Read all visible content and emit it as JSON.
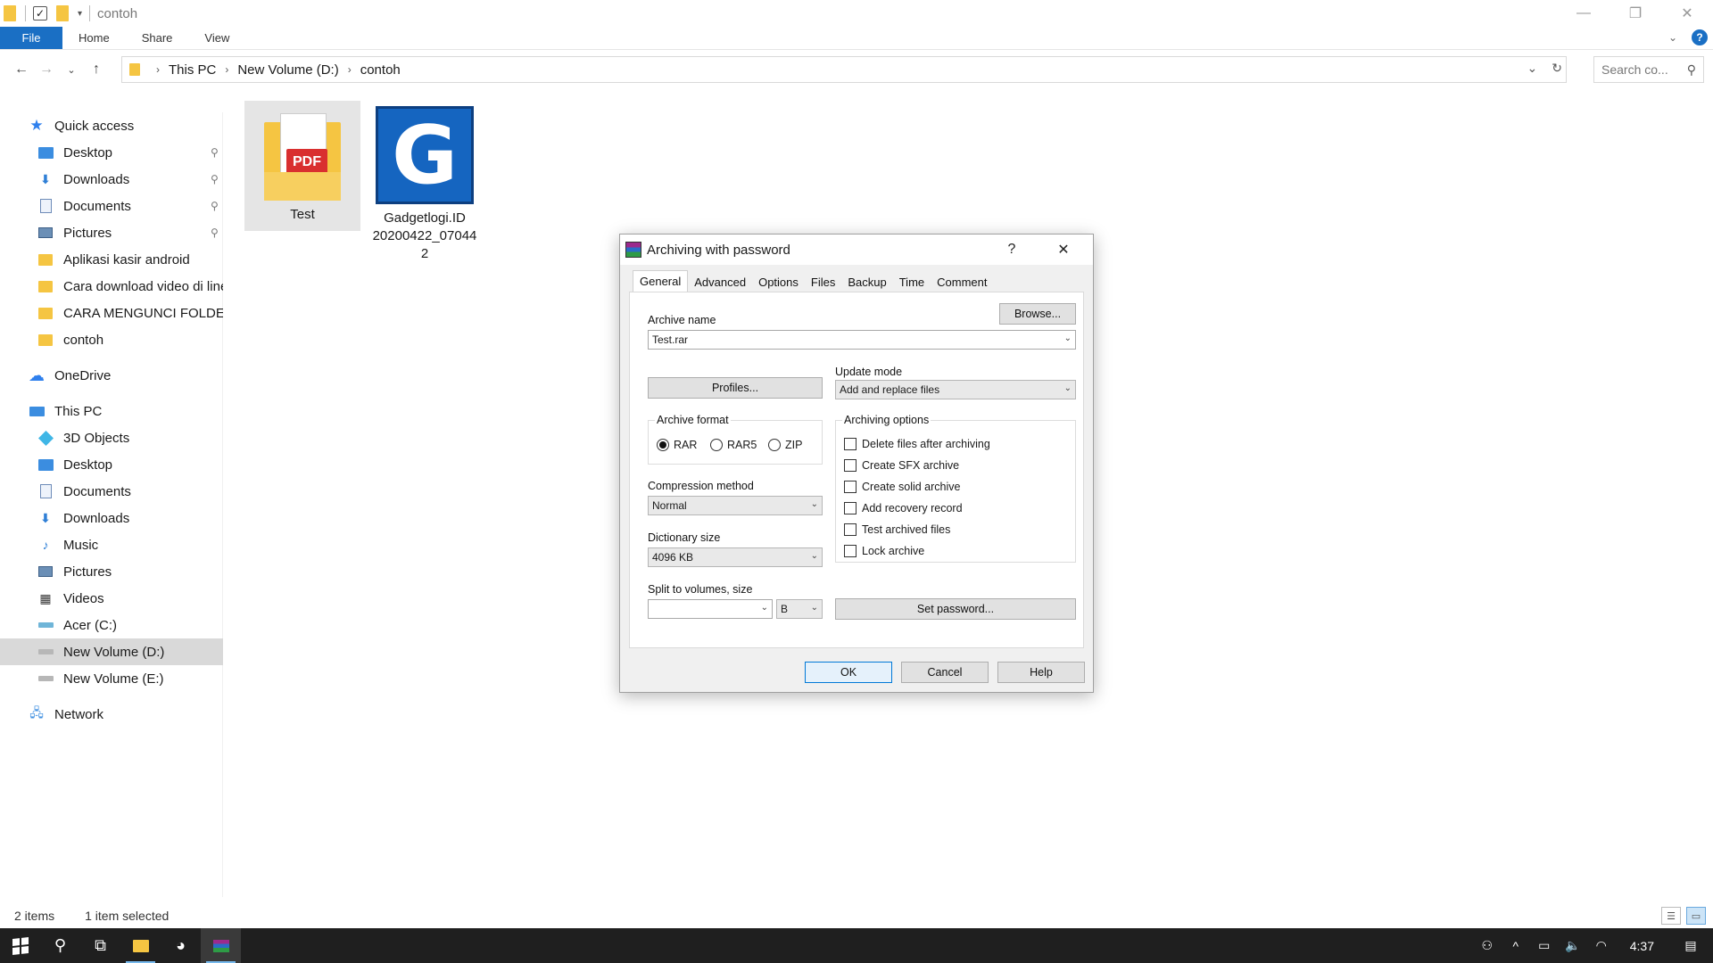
{
  "window": {
    "title": "contoh",
    "controls": {
      "minimize": "—",
      "restore": "❐",
      "close": "✕"
    }
  },
  "ribbon": {
    "tabs": [
      "File",
      "Home",
      "Share",
      "View"
    ]
  },
  "address": {
    "crumbs": [
      "This PC",
      "New Volume (D:)",
      "contoh"
    ],
    "search_placeholder": "Search co..."
  },
  "sidebar": {
    "quick_access": "Quick access",
    "quick_items": [
      {
        "label": "Desktop",
        "icon": "desktop-icon",
        "pinned": true
      },
      {
        "label": "Downloads",
        "icon": "downloads-icon",
        "pinned": true
      },
      {
        "label": "Documents",
        "icon": "documents-icon",
        "pinned": true
      },
      {
        "label": "Pictures",
        "icon": "pictures-icon",
        "pinned": true
      },
      {
        "label": "Aplikasi kasir android",
        "icon": "folder-icon",
        "pinned": false
      },
      {
        "label": "Cara download video di line",
        "icon": "folder-icon",
        "pinned": false
      },
      {
        "label": "CARA MENGUNCI FOLDER",
        "icon": "folder-icon",
        "pinned": false
      },
      {
        "label": "contoh",
        "icon": "folder-icon",
        "pinned": false
      }
    ],
    "onedrive": "OneDrive",
    "this_pc": "This PC",
    "pc_items": [
      {
        "label": "3D Objects",
        "icon": "3d-objects-icon"
      },
      {
        "label": "Desktop",
        "icon": "desktop-icon"
      },
      {
        "label": "Documents",
        "icon": "documents-icon"
      },
      {
        "label": "Downloads",
        "icon": "downloads-icon"
      },
      {
        "label": "Music",
        "icon": "music-icon"
      },
      {
        "label": "Pictures",
        "icon": "pictures-icon"
      },
      {
        "label": "Videos",
        "icon": "videos-icon"
      },
      {
        "label": "Acer (C:)",
        "icon": "drive-icon"
      },
      {
        "label": "New Volume (D:)",
        "icon": "drive-icon",
        "selected": true
      },
      {
        "label": "New Volume (E:)",
        "icon": "drive-icon"
      }
    ],
    "network": "Network"
  },
  "files": [
    {
      "name": "Test",
      "pdf_badge": "PDF",
      "selected": true
    },
    {
      "name": "Gadgetlogi.ID 20200422_070442",
      "thumb_letter": "G",
      "selected": false
    }
  ],
  "dialog": {
    "title": "Archiving with password",
    "help_btn": "?",
    "close_btn": "✕",
    "tabs": [
      "General",
      "Advanced",
      "Options",
      "Files",
      "Backup",
      "Time",
      "Comment"
    ],
    "archive_name_label": "Archive name",
    "browse": "Browse...",
    "archive_name_value": "Test.rar",
    "profiles": "Profiles...",
    "update_mode_label": "Update mode",
    "update_mode_value": "Add and replace files",
    "archive_format_label": "Archive format",
    "formats": [
      {
        "label": "RAR",
        "checked": true
      },
      {
        "label": "RAR5",
        "checked": false
      },
      {
        "label": "ZIP",
        "checked": false
      }
    ],
    "compression_label": "Compression method",
    "compression_value": "Normal",
    "dictionary_label": "Dictionary size",
    "dictionary_value": "4096 KB",
    "split_label": "Split to volumes, size",
    "split_value": "",
    "split_unit": "B",
    "options_label": "Archiving options",
    "options": [
      {
        "label": "Delete files after archiving",
        "checked": false
      },
      {
        "label": "Create SFX archive",
        "checked": false
      },
      {
        "label": "Create solid archive",
        "checked": false
      },
      {
        "label": "Add recovery record",
        "checked": false
      },
      {
        "label": "Test archived files",
        "checked": false
      },
      {
        "label": "Lock archive",
        "checked": false
      }
    ],
    "set_password": "Set password...",
    "ok": "OK",
    "cancel": "Cancel",
    "help": "Help"
  },
  "status": {
    "items": "2 items",
    "selected": "1 item selected"
  },
  "taskbar": {
    "time": "4:37"
  }
}
